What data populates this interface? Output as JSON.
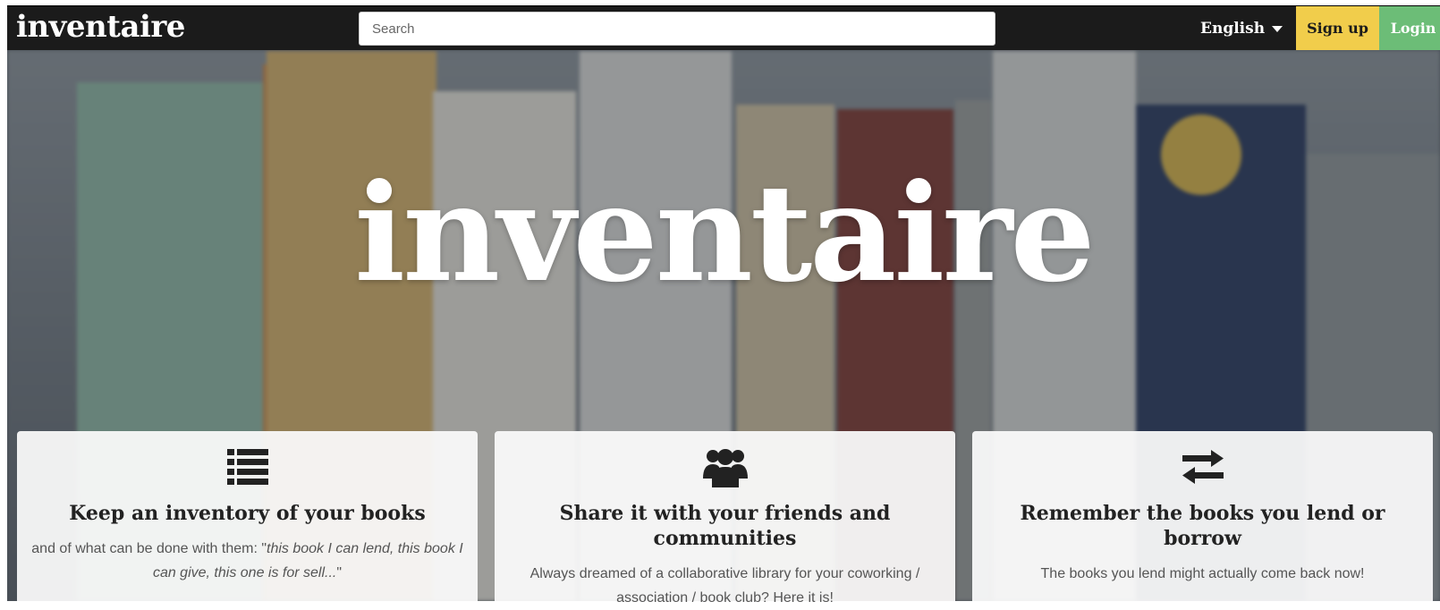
{
  "header": {
    "logo": "inventaire",
    "search_placeholder": "Search",
    "language_label": "English",
    "signup_label": "Sign up",
    "login_label": "Login"
  },
  "hero": {
    "title": "inventaire"
  },
  "features": [
    {
      "icon": "list-icon",
      "title": "Keep an inventory of your books",
      "text_prefix": "and of what can be done with them: \"",
      "text_quote": "this book I can lend, this book I can give, this one is for sell...",
      "text_suffix": "\""
    },
    {
      "icon": "users-icon",
      "title": "Share it with your friends and communities",
      "text": "Always dreamed of a collaborative library for your coworking / association / book club? Here it is!"
    },
    {
      "icon": "exchange-icon",
      "title": "Remember the books you lend or borrow",
      "text": "The books you lend might actually come back now!"
    }
  ],
  "colors": {
    "topbar": "#1b1b1b",
    "signup": "#f1cd4b",
    "login": "#6cbd77",
    "card": "#fafafa"
  }
}
